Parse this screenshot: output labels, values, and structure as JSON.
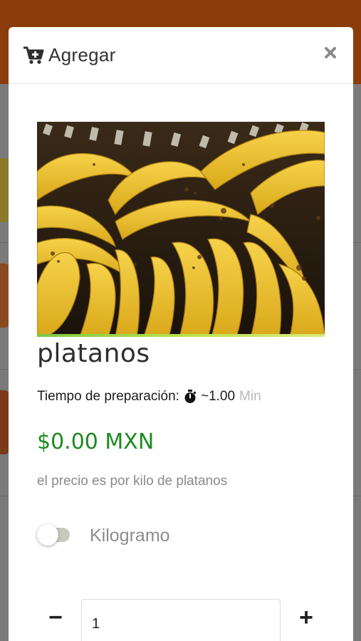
{
  "modal": {
    "title": "Agregar",
    "cart_icon": "cart-plus-icon",
    "close_icon": "close-icon"
  },
  "product": {
    "name": "platanos",
    "image_alt": "bananas",
    "prep_label": "Tiempo de preparación:",
    "prep_icon": "stopwatch-icon",
    "prep_value": "~1.00",
    "prep_unit": "Min",
    "price": "$0.00 MXN",
    "price_note": "el precio es por kilo de platanos",
    "price_color": "#1e8a1e"
  },
  "unit_toggle": {
    "label": "Kilogramo",
    "checked": false
  },
  "quantity": {
    "minus_label": "−",
    "value": "1",
    "plus_label": "+"
  },
  "colors": {
    "header_brand": "#8a3d0a"
  }
}
